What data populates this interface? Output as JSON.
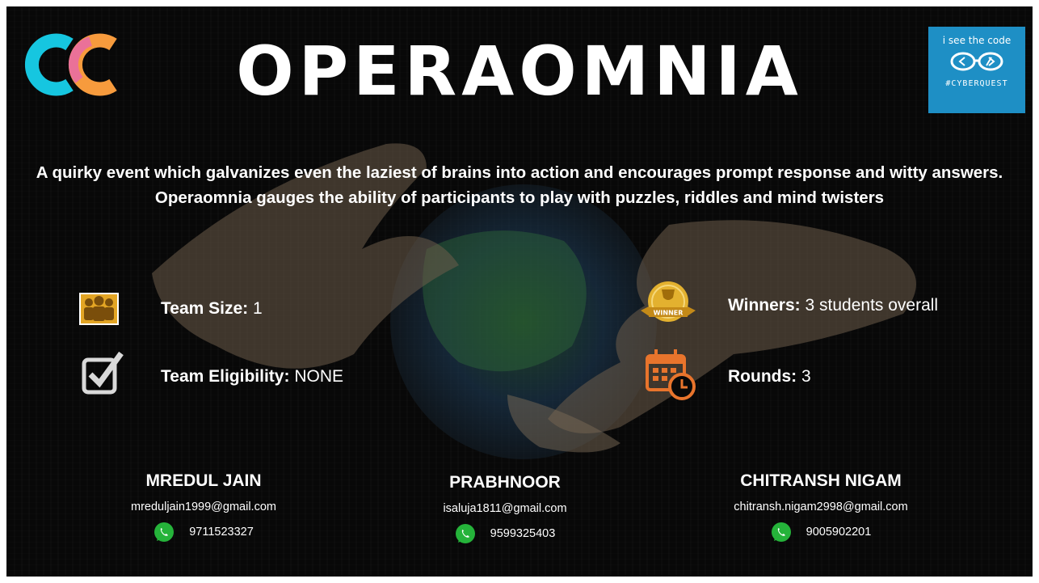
{
  "title": "OPERAOMNIA",
  "logo_right": {
    "top_text": "i see the code",
    "tag": "#CYBERQUEST"
  },
  "description": "A quirky event which galvanizes even the laziest of brains into action and encourages prompt response and witty answers. Operaomnia gauges the ability of participants to play with puzzles, riddles and mind twisters",
  "details": {
    "team_size": {
      "label": "Team Size:",
      "value": "1"
    },
    "eligibility": {
      "label": "Team Eligibility:",
      "value": "NONE"
    },
    "winners": {
      "label": "Winners:",
      "value": "3 students overall"
    },
    "rounds": {
      "label": "Rounds:",
      "value": "3"
    }
  },
  "winner_badge": "WINNER",
  "contacts": [
    {
      "name": "MREDUL JAIN",
      "email": "mreduljain1999@gmail.com",
      "phone": "9711523327"
    },
    {
      "name": "PRABHNOOR",
      "email": "isaluja1811@gmail.com",
      "phone": "9599325403"
    },
    {
      "name": "CHITRANSH NIGAM",
      "email": "chitransh.nigam2998@gmail.com",
      "phone": "9005902201"
    }
  ],
  "colors": {
    "background": "#080808",
    "accent_blue": "#1e8fc5",
    "whatsapp": "#25b33a",
    "calendar": "#e8742c",
    "medal": "#e3b12f"
  }
}
